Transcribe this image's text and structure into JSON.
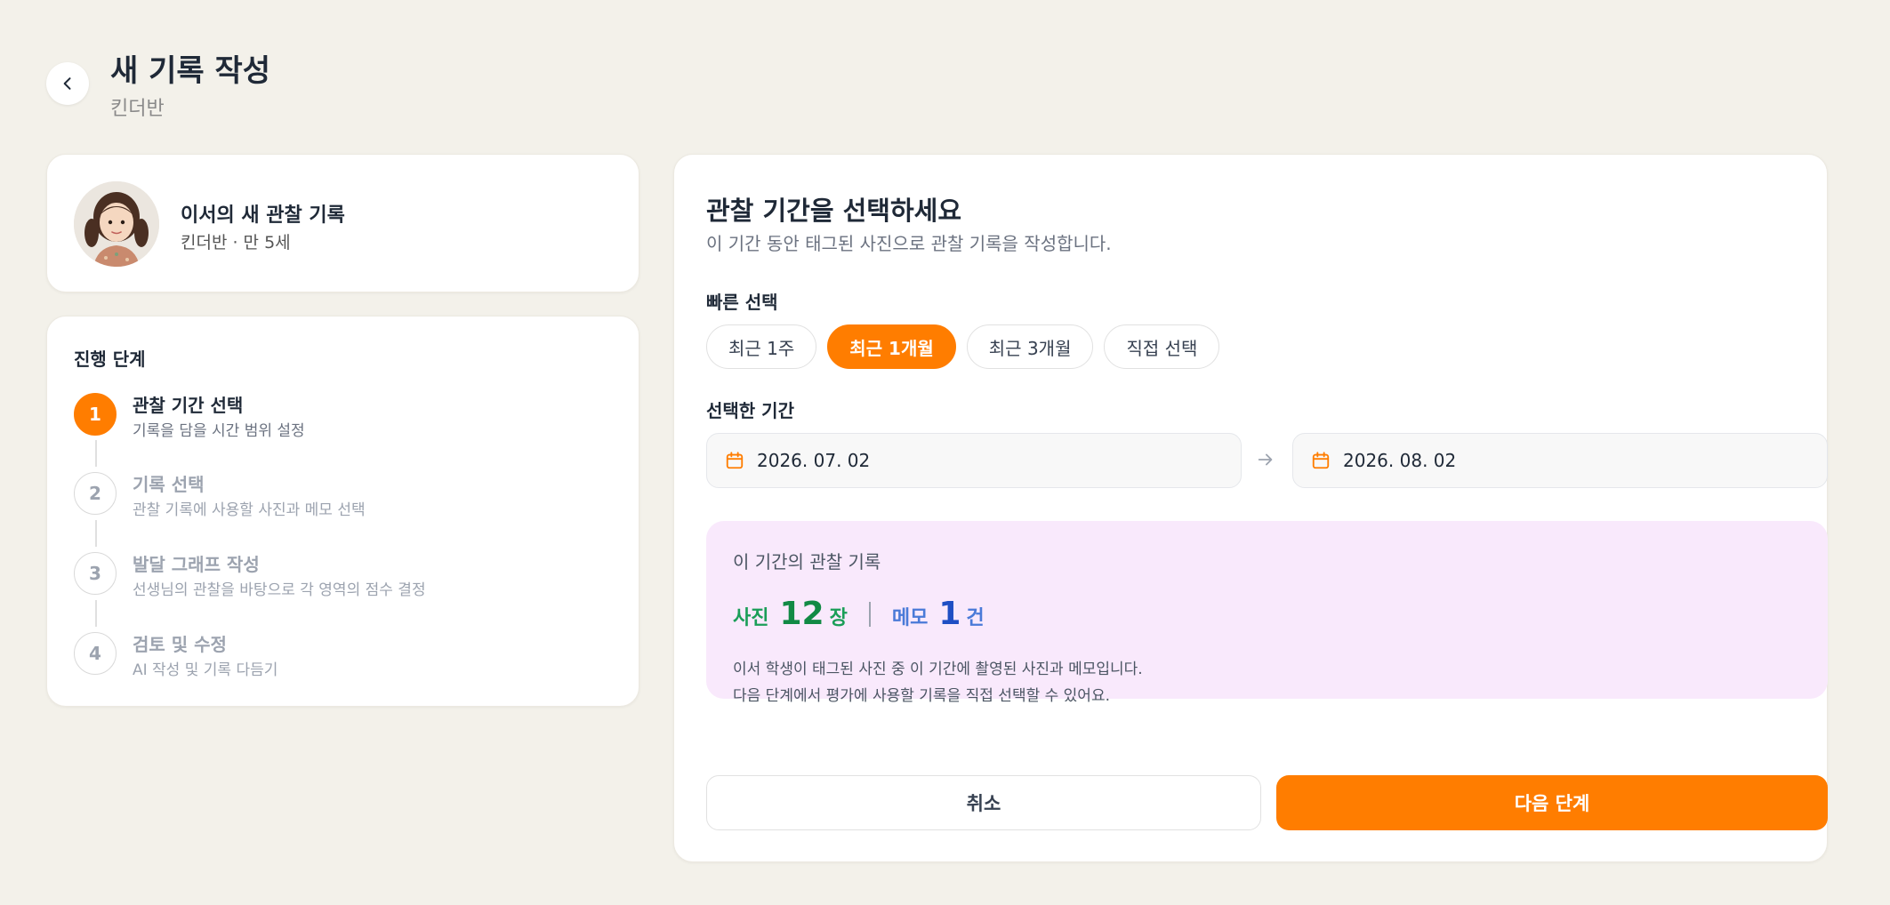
{
  "header": {
    "title": "새 기록 작성",
    "subtitle": "킨더반"
  },
  "student": {
    "name": "이서의 새 관찰 기록",
    "meta": "킨더반 · 만 5세"
  },
  "steps": {
    "title": "진행 단계",
    "items": [
      {
        "number": "1",
        "label": "관찰 기간 선택",
        "desc": "기록을 담을 시간 범위 설정",
        "active": true
      },
      {
        "number": "2",
        "label": "기록 선택",
        "desc": "관찰 기록에 사용할 사진과 메모 선택",
        "active": false
      },
      {
        "number": "3",
        "label": "발달 그래프 작성",
        "desc": "선생님의 관찰을 바탕으로 각 영역의 점수 결정",
        "active": false
      },
      {
        "number": "4",
        "label": "검토 및 수정",
        "desc": "AI 작성 및 기록 다듬기",
        "active": false
      }
    ]
  },
  "main": {
    "title": "관찰 기간을 선택하세요",
    "desc": "이 기간 동안 태그된 사진으로 관찰 기록을 작성합니다.",
    "quick_label": "빠른 선택",
    "quick_options": [
      "최근 1주",
      "최근 1개월",
      "최근 3개월",
      "직접 선택"
    ],
    "quick_selected": "최근 1개월",
    "range_label": "선택한 기간",
    "start_date": "2026. 07. 02",
    "end_date": "2026. 08. 02"
  },
  "summary": {
    "title": "이 기간의 관찰 기록",
    "photo_label": "사진",
    "photo_count": "12",
    "photo_unit": "장",
    "memo_label": "메모",
    "memo_count": "1",
    "memo_unit": "건",
    "note_1": "이서 학생이 태그된 사진 중 이 기간에 촬영된 사진과 메모입니다.",
    "note_2": "다음 단계에서 평가에 사용할 기록을 직접 선택할 수 있어요."
  },
  "actions": {
    "cancel": "취소",
    "next": "다음 단계"
  },
  "colors": {
    "accent": "#ff7d00",
    "background": "#f3f1ea",
    "summary_bg": "#f9e9fc",
    "photo_stat": "#128a45",
    "memo_stat": "#1f4fc4"
  }
}
